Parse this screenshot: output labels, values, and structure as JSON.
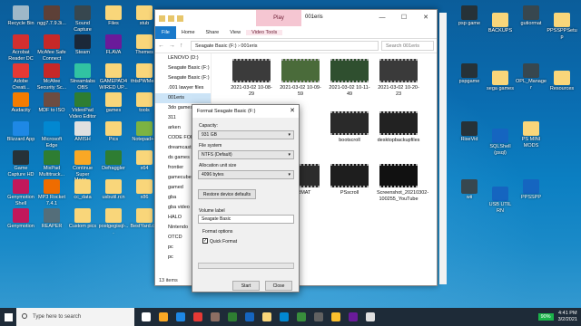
{
  "desktop": {
    "icons": [
      {
        "label": "Recycle Bin",
        "color": "#9fb8c8"
      },
      {
        "label": "Acrobat Reader DC",
        "color": "#d32f2f"
      },
      {
        "label": "Adobe Creati...",
        "color": "#e53935"
      },
      {
        "label": "Audacity",
        "color": "#f57c00"
      },
      {
        "label": "Blizzard App",
        "color": "#1e88e5"
      },
      {
        "label": "Game Capture HD",
        "color": "#263238"
      },
      {
        "label": "Genymotion Shell",
        "color": "#c2185b"
      },
      {
        "label": "Genymotion",
        "color": "#c2185b"
      },
      {
        "label": "ngg7.7.9.3i...",
        "color": "#5d4037"
      },
      {
        "label": "McAfee Safe Connect",
        "color": "#c62828"
      },
      {
        "label": "McAfee Security Sc...",
        "color": "#c62828"
      },
      {
        "label": "MDF to ISO",
        "color": "#6d4c41"
      },
      {
        "label": "Microsoft Edge",
        "color": "#0288d1"
      },
      {
        "label": "MixPad Multitrack...",
        "color": "#2e7d32"
      },
      {
        "label": "MP3 Rocket 7.4.1",
        "color": "#ef6c00"
      },
      {
        "label": "REAPER",
        "color": "#546e7a"
      },
      {
        "label": "Sound Capture",
        "color": "#37474f"
      },
      {
        "label": "Steam",
        "color": "#1b2838"
      },
      {
        "label": "Streamlabs OBS",
        "color": "#31c3a2"
      },
      {
        "label": "VideoPad Video Editor",
        "color": "#2e7d32"
      },
      {
        "label": "AMISH",
        "color": "#e0e0e0"
      },
      {
        "label": "Continue Super Mario...",
        "color": "#f9a825"
      },
      {
        "label": "cc_data",
        "color": "#f9d67a"
      },
      {
        "label": "Custom pics",
        "color": "#f9d67a"
      },
      {
        "label": "Files",
        "color": "#f9d67a"
      },
      {
        "label": "FLAVA",
        "color": "#6a1b9a"
      },
      {
        "label": "GAMEPAD4 WIRED UP...",
        "color": "#f9d67a"
      },
      {
        "label": "games",
        "color": "#f9d67a"
      },
      {
        "label": "Pics",
        "color": "#f9d67a"
      },
      {
        "label": "Defraggler",
        "color": "#2e7d32"
      },
      {
        "label": "usbutil.rcn",
        "color": "#f9d67a"
      },
      {
        "label": "postgegisql-...",
        "color": "#f9d67a"
      },
      {
        "label": "stub",
        "color": "#f9d67a"
      },
      {
        "label": "Themes",
        "color": "#f9d67a"
      },
      {
        "label": "thtsPWMe...",
        "color": "#f9d67a"
      },
      {
        "label": "tools",
        "color": "#f9d67a"
      },
      {
        "label": "Notepad++",
        "color": "#7cb342"
      },
      {
        "label": "x64",
        "color": "#f9d67a"
      },
      {
        "label": "x86",
        "color": "#f9d67a"
      },
      {
        "label": "BestYard.c...",
        "color": "#f9d67a"
      },
      {
        "label": "psp game",
        "color": "#263238"
      },
      {
        "label": "pspgame",
        "color": "#263238"
      },
      {
        "label": "RiseVid",
        "color": "#263238"
      },
      {
        "label": "wii",
        "color": "#37474f"
      },
      {
        "label": "BACKUPS",
        "color": "#f9d67a"
      },
      {
        "label": "sega games",
        "color": "#f9d67a"
      },
      {
        "label": "SQLShell (psql)",
        "color": "#1565c0"
      },
      {
        "label": "USB UTIL RN",
        "color": "#1565c0"
      },
      {
        "label": "gutiormat",
        "color": "#37474f"
      },
      {
        "label": "OPL_Manager",
        "color": "#37474f"
      },
      {
        "label": "PS MINI MODS",
        "color": "#f9d67a"
      },
      {
        "label": "PPSSPP",
        "color": "#1565c0"
      },
      {
        "label": "PPSSPPSetup",
        "color": "#f9d67a"
      },
      {
        "label": "Resources",
        "color": "#f9d67a"
      }
    ]
  },
  "explorer": {
    "title": "001eris",
    "play_tab": "Play",
    "tabs": [
      "File",
      "Home",
      "Share",
      "View",
      "Video Tools"
    ],
    "path": "Seagate Basic (F:) › 001eris",
    "search_placeholder": "Search 001eris",
    "nav": [
      "LENOVO (D:)",
      "Seagate Basic (F:)",
      "Seagate Basic (F:)",
      ".001 lawyer files",
      "001eris",
      "3do games",
      "311",
      "arken",
      "CODE FOR G...",
      "dreamcast",
      "ds games",
      "frontier",
      "gamecube",
      "gamed",
      "gba",
      "gba video",
      "HALO",
      "Nintendo",
      "OTCD",
      "pc",
      "pc"
    ],
    "items": [
      {
        "name": "2021-03-02 10-08-29"
      },
      {
        "name": "2021-03-02 10-09-59"
      },
      {
        "name": "2021-03-02 10-11-49"
      },
      {
        "name": "2021-03-02 10-20-23"
      },
      {
        "name": "2021-03-02 10-28-..."
      },
      {
        "name": "bootscroll"
      },
      {
        "name": "desktopbackupfiles"
      },
      {
        "name": "FORMAT"
      },
      {
        "name": "PSscroll"
      },
      {
        "name": "Screenshot_20210302-100255_YouTube"
      }
    ],
    "status": "13 items"
  },
  "format_dialog": {
    "title": "Format Seagate Basic (F:)",
    "capacity_label": "Capacity:",
    "capacity_value": "931 GB",
    "filesystem_label": "File system",
    "filesystem_value": "NTFS (Default)",
    "alloc_label": "Allocation unit size",
    "alloc_value": "4096 bytes",
    "restore_button": "Restore device defaults",
    "volume_label": "Volume label",
    "volume_value": "Seagate Basic",
    "format_options_label": "Format options",
    "quick_format_label": "Quick Format",
    "quick_format_checked": true,
    "start_button": "Start",
    "close_button": "Close"
  },
  "taskbar": {
    "search_placeholder": "Type here to search",
    "battery": "90%",
    "time": "4:41 PM",
    "date": "3/2/2021",
    "app_colors": [
      "#ffffff",
      "#f9a825",
      "#1e88e5",
      "#e53935",
      "#8d6e63",
      "#2e7d32",
      "#1565c0",
      "#f9d67a",
      "#0288d1",
      "#388e3c",
      "#616161",
      "#fbc02d",
      "#6a1b9a",
      "#e0e0e0"
    ]
  }
}
